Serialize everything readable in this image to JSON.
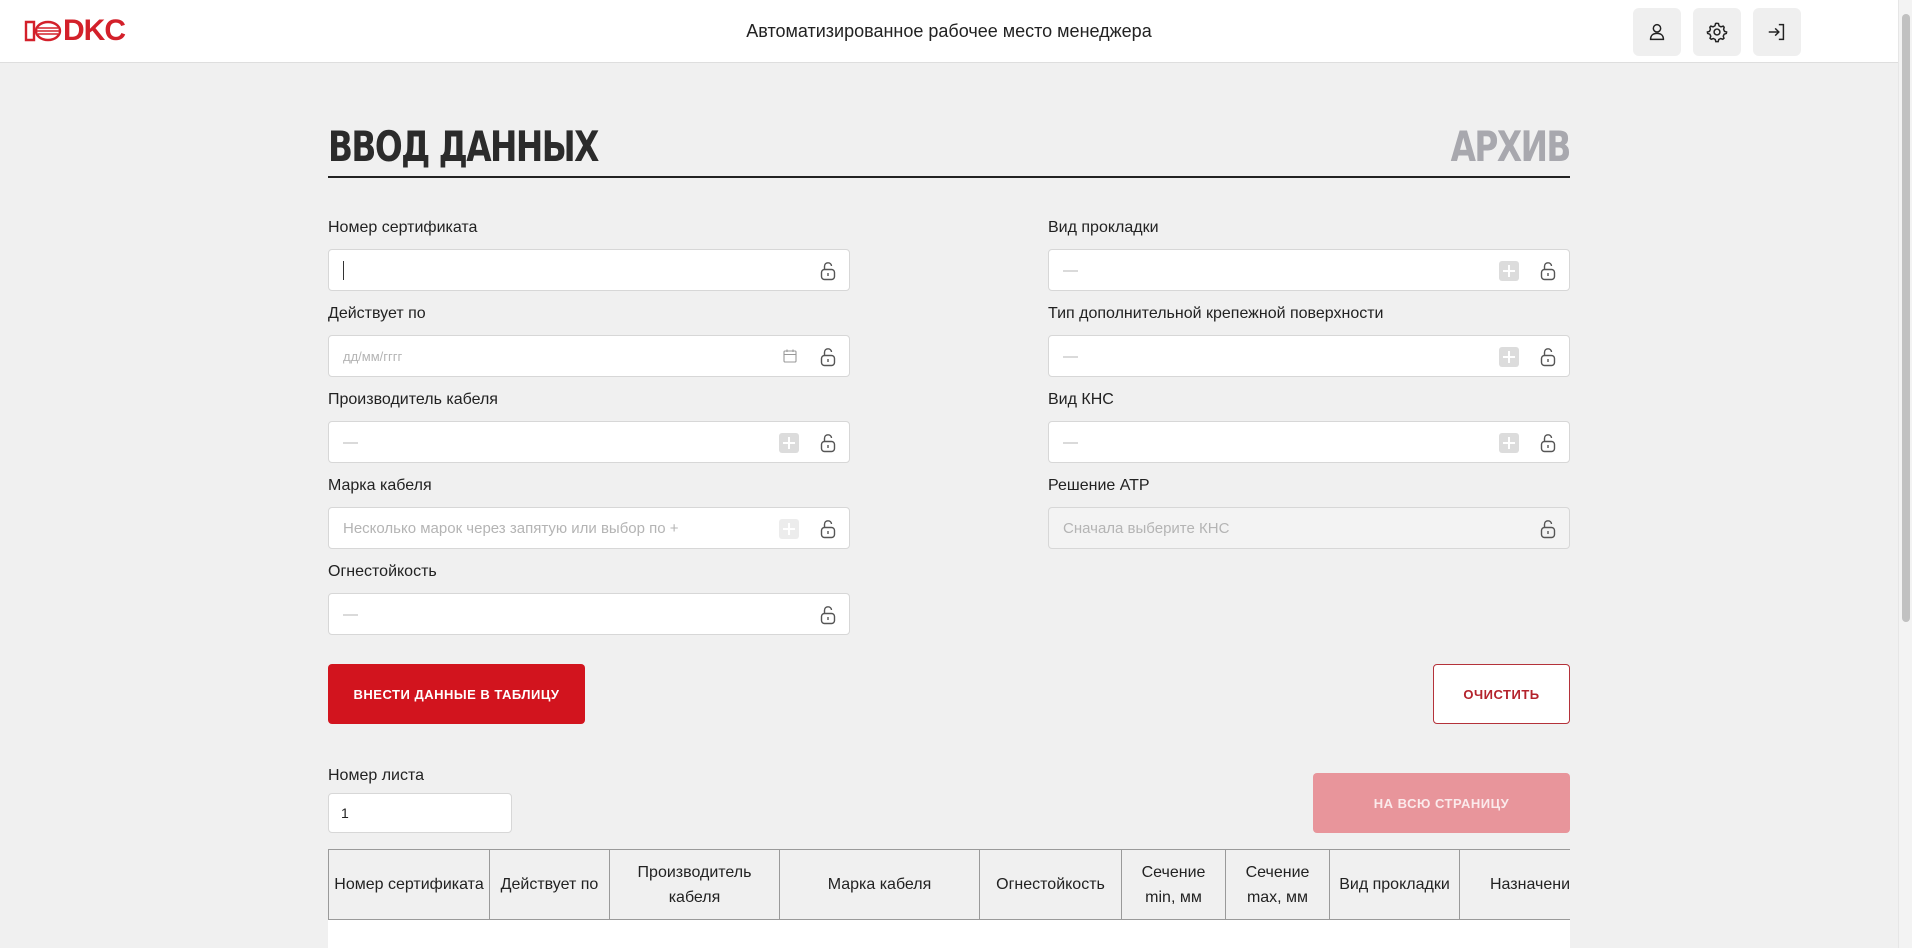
{
  "header": {
    "logo_text": "DKC",
    "app_title": "Автоматизированное рабочее место менеджера",
    "buttons": [
      {
        "icon": "user-icon"
      },
      {
        "icon": "gear-icon"
      },
      {
        "icon": "logout-icon"
      }
    ]
  },
  "tabs": {
    "input": "ВВОД ДАННЫХ",
    "archive": "АРХИВ"
  },
  "form": {
    "certificate_number": {
      "label": "Номер сертификата",
      "value": ""
    },
    "valid_until": {
      "label": "Действует по",
      "placeholder": "дд/мм/гггг"
    },
    "cable_manufacturer": {
      "label": "Производитель кабеля",
      "placeholder": "—"
    },
    "cable_brand": {
      "label": "Марка кабеля",
      "placeholder": "Несколько марок через запятую или выбор по +"
    },
    "fire_resistance": {
      "label": "Огнестойкость",
      "placeholder": "—"
    },
    "laying_type": {
      "label": "Вид прокладки",
      "placeholder": "—"
    },
    "mount_surface_type": {
      "label": "Тип дополнительной крепежной поверхности",
      "placeholder": "—"
    },
    "kns_type": {
      "label": "Вид КНС",
      "placeholder": "—"
    },
    "atr_solution": {
      "label": "Решение АТР",
      "placeholder": "Сначала выберите КНС"
    }
  },
  "actions": {
    "submit": "ВНЕСТИ ДАННЫЕ В ТАБЛИЦУ",
    "clear": "ОЧИСТИТЬ",
    "fullpage": "НА ВСЮ СТРАНИЦУ"
  },
  "sheet": {
    "label": "Номер листа",
    "value": "1"
  },
  "table": {
    "columns": [
      "Номер сертификата",
      "Действует по",
      "Производитель кабеля",
      "Марка кабеля",
      "Огнестойкость",
      "Сечение min, мм",
      "Сечение max, мм",
      "Вид прокладки",
      "Назначение"
    ]
  },
  "colors": {
    "brand": "#d3202a",
    "primary_button": "#d2141e",
    "disabled_button": "#e8959b",
    "page_bg": "#f0f0f0"
  }
}
